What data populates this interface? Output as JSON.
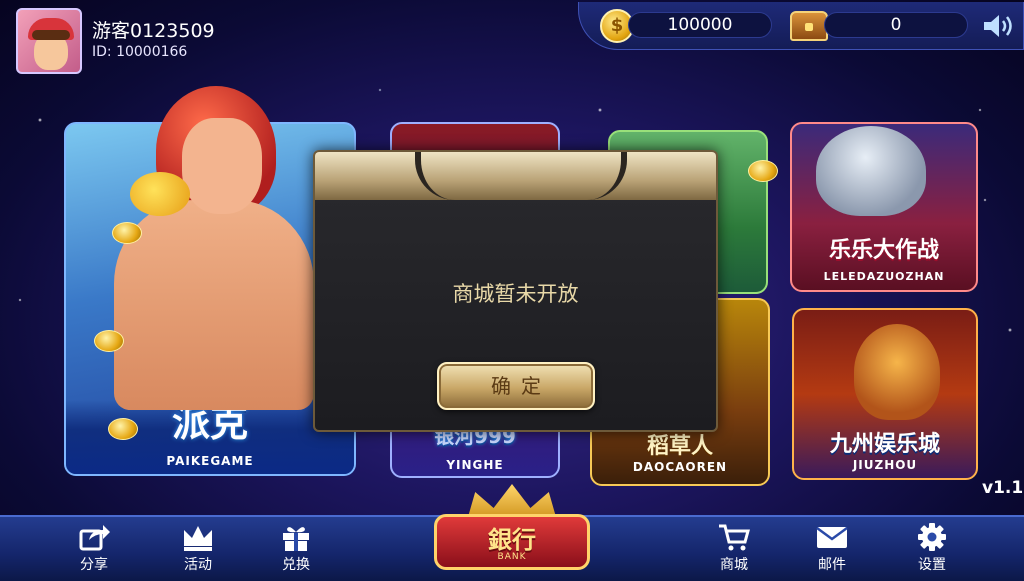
{
  "user": {
    "name": "游客0123509",
    "id_text": "ID: 10000166"
  },
  "wallet": {
    "coins": "100000",
    "bank": "0"
  },
  "games": [
    {
      "title": "派克",
      "subtitle": "PAIKEGAME"
    },
    {
      "title": "银河999",
      "subtitle": "YINGHE"
    },
    {
      "title": "稻草人",
      "subtitle": "DAOCAOREN"
    },
    {
      "title": "乐乐大作战",
      "subtitle": "LELEDAZUOZHAN"
    },
    {
      "title": "九州娱乐城",
      "subtitle": "JIUZHOU"
    }
  ],
  "version": "v1.1",
  "modal": {
    "message": "商城暂未开放",
    "confirm_label": "确定"
  },
  "bottom_nav": {
    "share": "分享",
    "activity": "活动",
    "redeem": "兑换",
    "bank_title": "銀行",
    "bank_sub": "BANK",
    "shop": "商城",
    "mail": "邮件",
    "settings": "设置"
  },
  "colors": {
    "background": "#1d1660",
    "modal_text": "#e9d9a8",
    "gold_button": "#c9a767",
    "nav_bar": "#14256a"
  },
  "icons": [
    "coin-icon",
    "treasure-chest-icon",
    "sound-icon",
    "share-icon",
    "crown-icon",
    "gift-icon",
    "cart-icon",
    "mail-icon",
    "gear-icon"
  ]
}
